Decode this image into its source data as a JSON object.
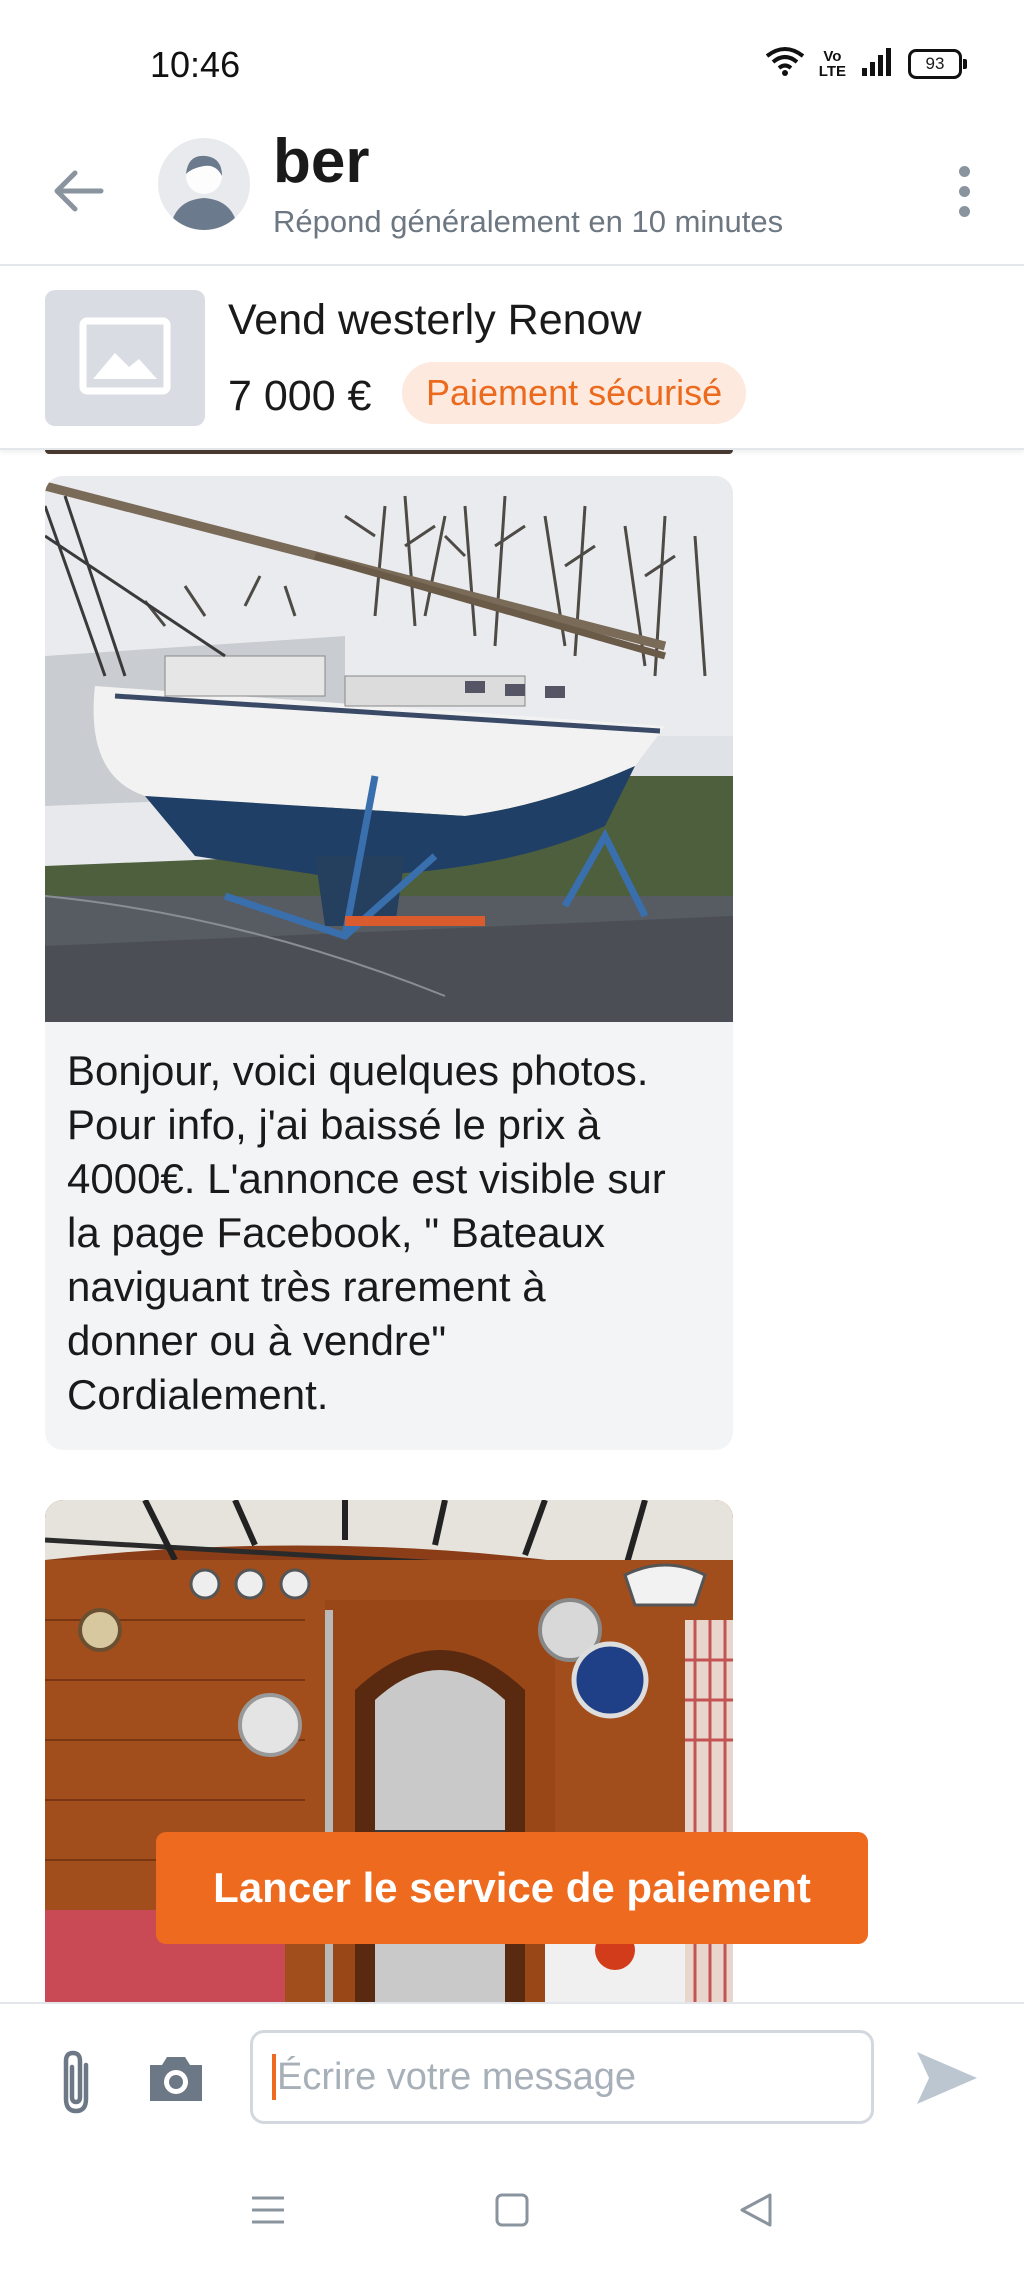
{
  "status_bar": {
    "time": "10:46",
    "volte": "Vo\nLTE",
    "battery": "93"
  },
  "header": {
    "back_icon": "arrow-left-icon",
    "contact_name": "ber",
    "contact_status": "Répond généralement en 10 minutes",
    "menu_icon": "more-vertical-icon"
  },
  "listing": {
    "thumbnail_icon": "image-placeholder-icon",
    "title": "Vend westerly Renow",
    "price": "7 000 €",
    "badge": "Paiement sécurisé"
  },
  "messages": [
    {
      "type": "image",
      "icon": "boat-photo"
    },
    {
      "type": "text",
      "text": "Bonjour, voici quelques photos.\nPour info, j'ai baissé le prix à\n4000€. L'annonce est visible sur\nla page Facebook, \" Bateaux\nnaviguant très rarement à\ndonner ou à vendre\"\nCordialement."
    },
    {
      "type": "image",
      "icon": "cabin-photo"
    }
  ],
  "payment_button": "Lancer le service de paiement",
  "composer": {
    "placeholder": "Écrire votre message",
    "value": ""
  },
  "colors": {
    "accent": "#ee6a1e",
    "badge_bg": "#fde9dd",
    "bubble_bg": "#f3f4f6",
    "muted_text": "#6d7782"
  }
}
